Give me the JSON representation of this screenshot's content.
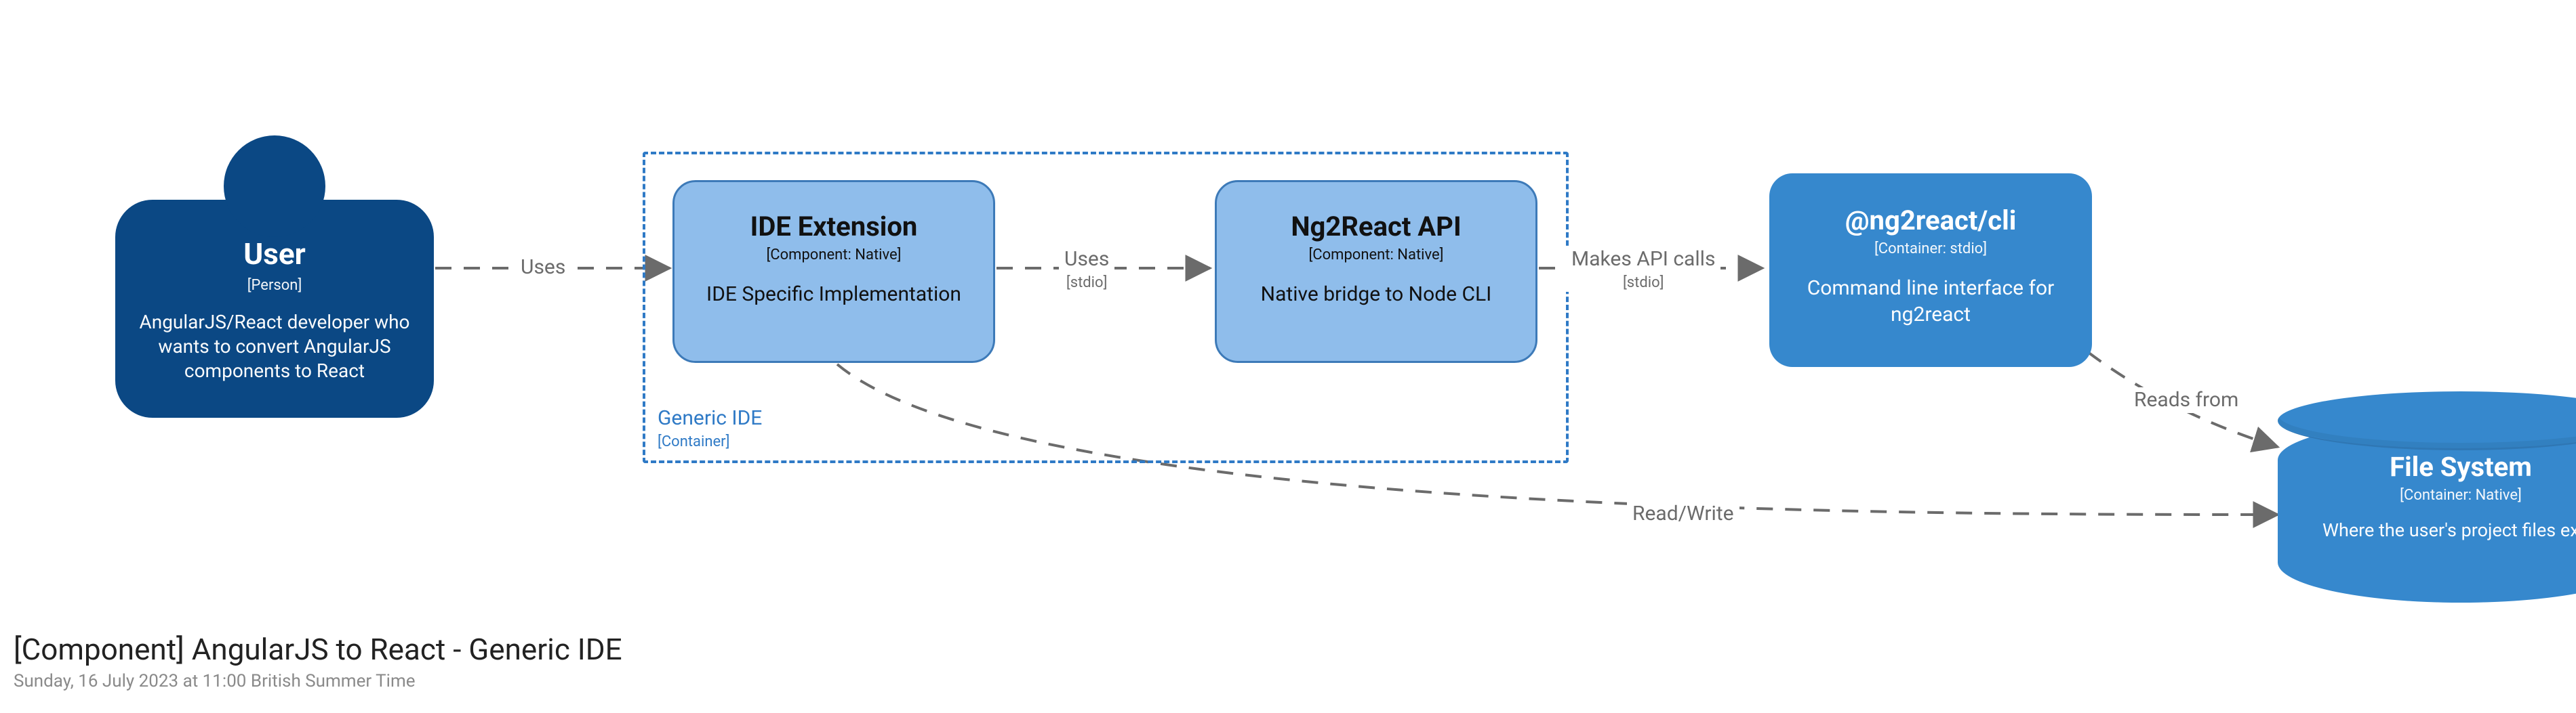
{
  "title": "[Component] AngularJS to React - Generic IDE",
  "timestamp": "Sunday, 16 July 2023 at 11:00 British Summer Time",
  "nodes": {
    "user": {
      "name": "User",
      "stereotype": "[Person]",
      "description": "AngularJS/React developer who wants to convert AngularJS components to React"
    },
    "boundary": {
      "name": "Generic IDE",
      "stereotype": "[Container]"
    },
    "ide_ext": {
      "name": "IDE Extension",
      "stereotype": "[Component: Native]",
      "description": "IDE Specific Implementation"
    },
    "api": {
      "name": "Ng2React API",
      "stereotype": "[Component: Native]",
      "description": "Native bridge to Node CLI"
    },
    "cli": {
      "name": "@ng2react/cli",
      "stereotype": "[Container: stdio]",
      "description": "Command line interface for ng2react"
    },
    "fs": {
      "name": "File System",
      "stereotype": "[Container: Native]",
      "description": "Where the user's project files exist"
    }
  },
  "edges": {
    "user_ide": {
      "label": "Uses",
      "tech": ""
    },
    "ide_api": {
      "label": "Uses",
      "tech": "[stdio]"
    },
    "api_cli": {
      "label": "Makes API calls",
      "tech": "[stdio]"
    },
    "cli_fs": {
      "label": "Reads from",
      "tech": ""
    },
    "ide_fs": {
      "label": "Read/Write",
      "tech": ""
    }
  }
}
